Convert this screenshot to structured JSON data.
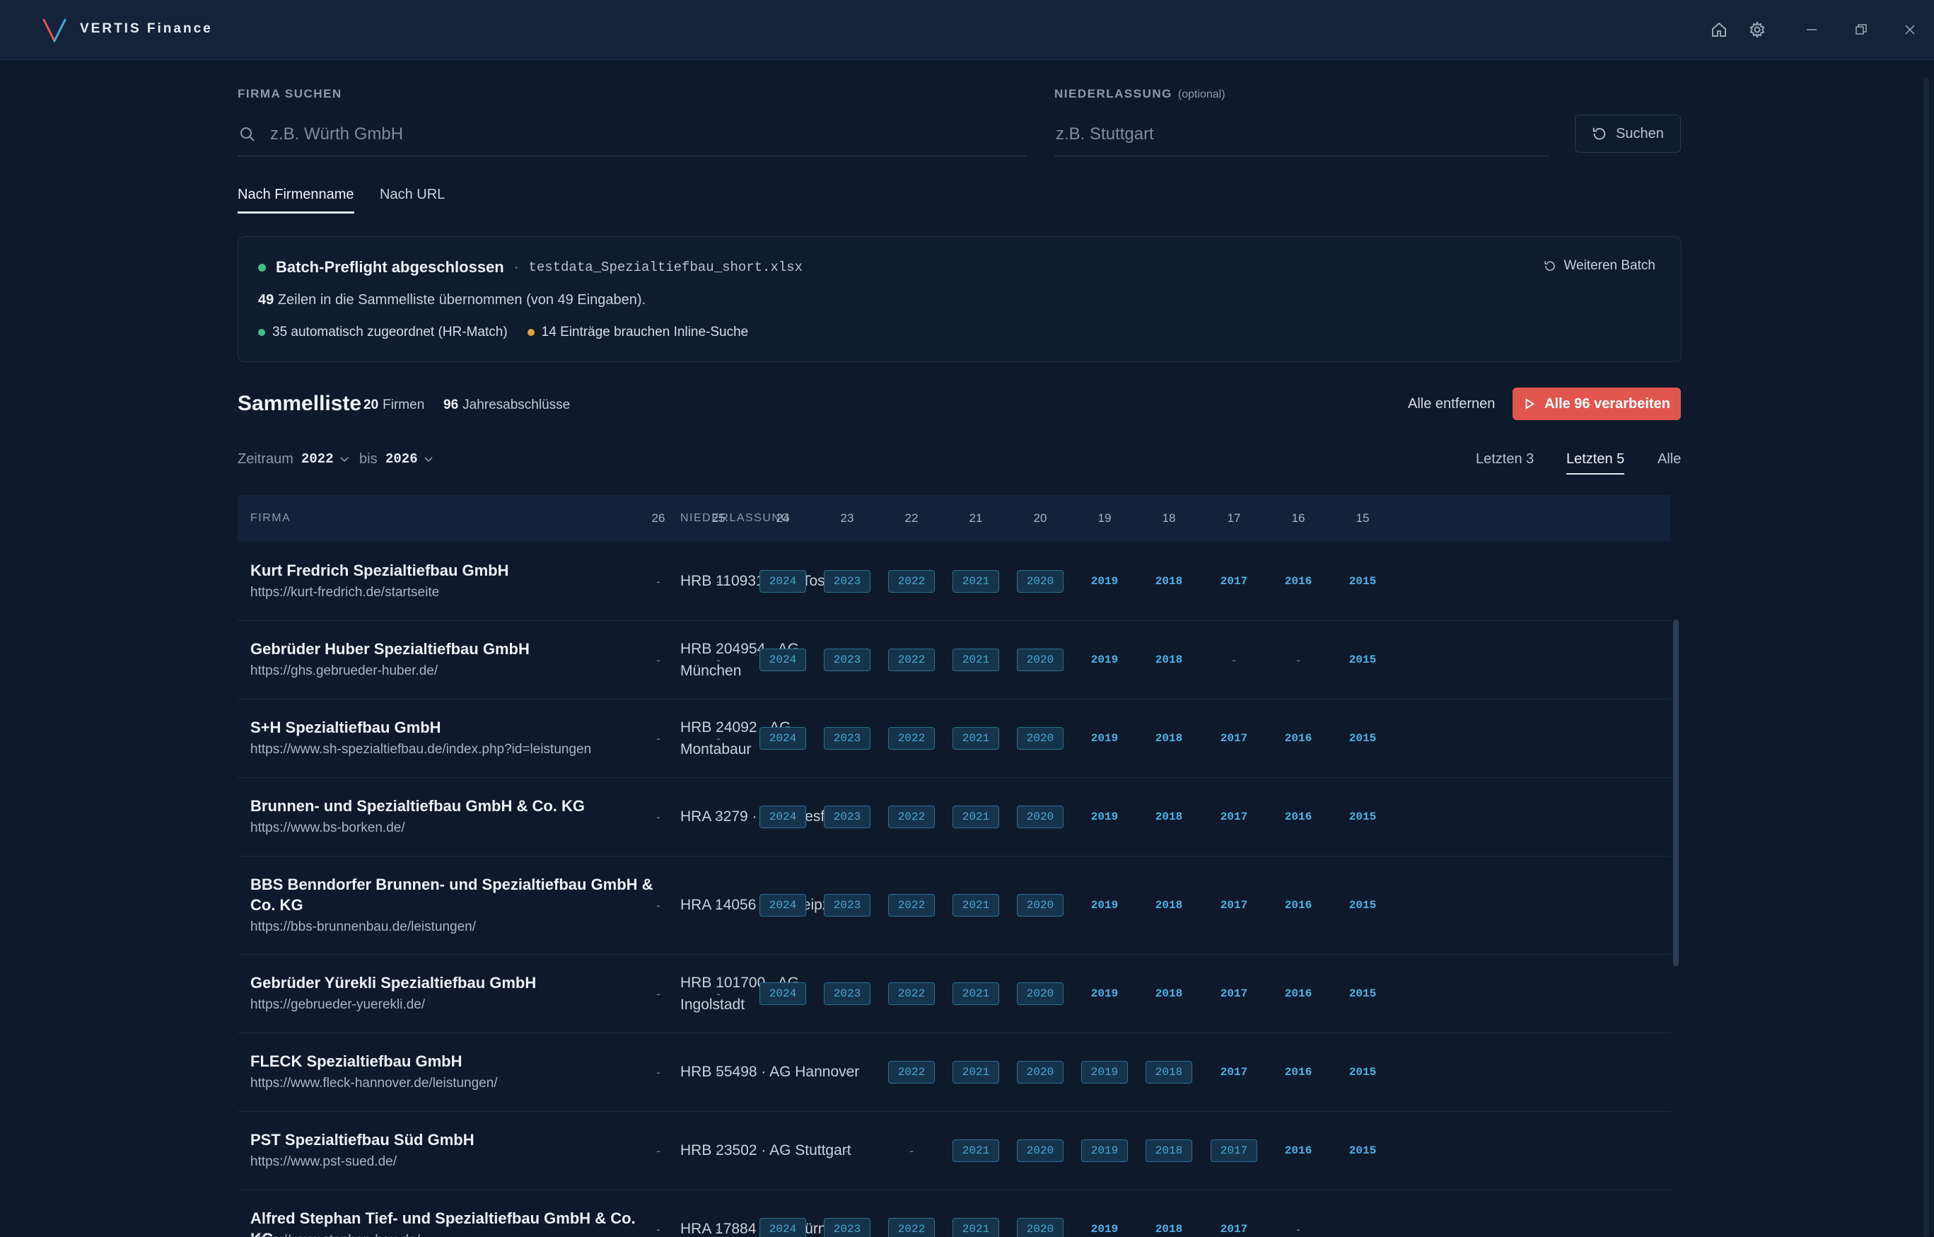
{
  "app": {
    "title": "VERTIS Finance"
  },
  "search": {
    "firm_label": "FIRMA SUCHEN",
    "firm_placeholder": "z.B. Würth GmbH",
    "branch_label": "NIEDERLASSUNG",
    "branch_optional": "(optional)",
    "branch_placeholder": "z.B. Stuttgart",
    "search_button": "Suchen"
  },
  "tabs": [
    {
      "label": "Nach Firmenname",
      "active": true
    },
    {
      "label": "Nach URL",
      "active": false
    }
  ],
  "batch": {
    "title": "Batch-Preflight abgeschlossen",
    "separator": "·",
    "filename": "testdata_Spezialtiefbau_short.xlsx",
    "count": "49",
    "summary": "Zeilen in die Sammelliste übernommen (von 49 Eingaben).",
    "matched": "35 automatisch zugeordnet (HR-Match)",
    "inline": "14 Einträge brauchen Inline-Suche",
    "more_button": "Weiteren Batch",
    "status_colors": {
      "ok": "#3fc08a",
      "pending": "#e3a13b"
    }
  },
  "sammelliste": {
    "title": "Sammelliste",
    "firms_count": "20",
    "firms_label": "Firmen",
    "reports_count": "96",
    "reports_label": "Jahresabschlüsse",
    "remove_all": "Alle entfernen",
    "process_all": "Alle 96 verarbeiten"
  },
  "period": {
    "label": "Zeitraum",
    "from": "2022",
    "to_label": "bis",
    "to": "2026",
    "quick": [
      {
        "label": "Letzten 3",
        "active": false
      },
      {
        "label": "Letzten 5",
        "active": true
      },
      {
        "label": "Alle",
        "active": false
      }
    ]
  },
  "table": {
    "col_firma": "FIRMA",
    "col_niederlassung": "NIEDERLASSUNG",
    "years": [
      "26",
      "25",
      "24",
      "23",
      "22",
      "21",
      "20",
      "19",
      "18",
      "17",
      "16",
      "15"
    ],
    "rows": [
      {
        "name": "Kurt Fredrich Spezialtiefbau GmbH",
        "url": "https://kurt-fredrich.de/startseite",
        "branch": "HRB 110931 · AG Tostedt",
        "cells": [
          [
            "-",
            ""
          ],
          [
            "-",
            ""
          ],
          [
            "2024",
            "box"
          ],
          [
            "2023",
            "box"
          ],
          [
            "2022",
            "box"
          ],
          [
            "2021",
            "box"
          ],
          [
            "2020",
            "box"
          ],
          [
            "2019",
            "plain"
          ],
          [
            "2018",
            "plain"
          ],
          [
            "2017",
            "plain"
          ],
          [
            "2016",
            "plain"
          ],
          [
            "2015",
            "plain"
          ]
        ]
      },
      {
        "name": "Gebrüder Huber Spezialtiefbau GmbH",
        "url": "https://ghs.gebrueder-huber.de/",
        "branch": "HRB 204954 · AG München",
        "cells": [
          [
            "-",
            ""
          ],
          [
            "-",
            ""
          ],
          [
            "2024",
            "box"
          ],
          [
            "2023",
            "box"
          ],
          [
            "2022",
            "box"
          ],
          [
            "2021",
            "box"
          ],
          [
            "2020",
            "box"
          ],
          [
            "2019",
            "plain"
          ],
          [
            "2018",
            "plain"
          ],
          [
            "-",
            ""
          ],
          [
            "-",
            ""
          ],
          [
            "2015",
            "plain"
          ]
        ]
      },
      {
        "name": "S+H Spezialtiefbau GmbH",
        "url": "https://www.sh-spezialtiefbau.de/index.php?id=leistungen",
        "branch": "HRB 24092 · AG Montabaur",
        "cells": [
          [
            "-",
            ""
          ],
          [
            "-",
            ""
          ],
          [
            "2024",
            "box"
          ],
          [
            "2023",
            "box"
          ],
          [
            "2022",
            "box"
          ],
          [
            "2021",
            "box"
          ],
          [
            "2020",
            "box"
          ],
          [
            "2019",
            "plain"
          ],
          [
            "2018",
            "plain"
          ],
          [
            "2017",
            "plain"
          ],
          [
            "2016",
            "plain"
          ],
          [
            "2015",
            "plain"
          ]
        ]
      },
      {
        "name": "Brunnen- und Spezialtiefbau GmbH & Co. KG",
        "url": "https://www.bs-borken.de/",
        "branch": "HRA 3279 · AG Coesfeld",
        "cells": [
          [
            "-",
            ""
          ],
          [
            "-",
            ""
          ],
          [
            "2024",
            "box"
          ],
          [
            "2023",
            "box"
          ],
          [
            "2022",
            "box"
          ],
          [
            "2021",
            "box"
          ],
          [
            "2020",
            "box"
          ],
          [
            "2019",
            "plain"
          ],
          [
            "2018",
            "plain"
          ],
          [
            "2017",
            "plain"
          ],
          [
            "2016",
            "plain"
          ],
          [
            "2015",
            "plain"
          ]
        ]
      },
      {
        "name": "BBS Benndorfer Brunnen- und Spezialtiefbau GmbH & Co. KG",
        "url": "https://bbs-brunnenbau.de/leistungen/",
        "branch": "HRA 14056 · AG Leipzig",
        "cells": [
          [
            "-",
            ""
          ],
          [
            "-",
            ""
          ],
          [
            "2024",
            "box"
          ],
          [
            "2023",
            "box"
          ],
          [
            "2022",
            "box"
          ],
          [
            "2021",
            "box"
          ],
          [
            "2020",
            "box"
          ],
          [
            "2019",
            "plain"
          ],
          [
            "2018",
            "plain"
          ],
          [
            "2017",
            "plain"
          ],
          [
            "2016",
            "plain"
          ],
          [
            "2015",
            "plain"
          ]
        ]
      },
      {
        "name": "Gebrüder Yürekli Spezialtiefbau GmbH",
        "url": "https://gebrueder-yuerekli.de/",
        "branch": "HRB 101700 · AG Ingolstadt",
        "cells": [
          [
            "-",
            ""
          ],
          [
            "-",
            ""
          ],
          [
            "2024",
            "box"
          ],
          [
            "2023",
            "box"
          ],
          [
            "2022",
            "box"
          ],
          [
            "2021",
            "box"
          ],
          [
            "2020",
            "box"
          ],
          [
            "2019",
            "plain"
          ],
          [
            "2018",
            "plain"
          ],
          [
            "2017",
            "plain"
          ],
          [
            "2016",
            "plain"
          ],
          [
            "2015",
            "plain"
          ]
        ]
      },
      {
        "name": "FLECK Spezialtiefbau GmbH",
        "url": "https://www.fleck-hannover.de/leistungen/",
        "branch": "HRB 55498 · AG Hannover",
        "cells": [
          [
            "-",
            ""
          ],
          [
            "-",
            ""
          ],
          [
            "-",
            ""
          ],
          [
            "-",
            ""
          ],
          [
            "2022",
            "box"
          ],
          [
            "2021",
            "box"
          ],
          [
            "2020",
            "box"
          ],
          [
            "2019",
            "box"
          ],
          [
            "2018",
            "box"
          ],
          [
            "2017",
            "plain"
          ],
          [
            "2016",
            "plain"
          ],
          [
            "2015",
            "plain"
          ]
        ]
      },
      {
        "name": "PST Spezialtiefbau Süd GmbH",
        "url": "https://www.pst-sued.de/",
        "branch": "HRB 23502 · AG Stuttgart",
        "cells": [
          [
            "-",
            ""
          ],
          [
            "-",
            ""
          ],
          [
            "-",
            ""
          ],
          [
            "-",
            ""
          ],
          [
            "-",
            ""
          ],
          [
            "2021",
            "box"
          ],
          [
            "2020",
            "box"
          ],
          [
            "2019",
            "box"
          ],
          [
            "2018",
            "box"
          ],
          [
            "2017",
            "box"
          ],
          [
            "2016",
            "plain"
          ],
          [
            "2015",
            "plain"
          ]
        ]
      },
      {
        "name": "Alfred Stephan Tief- und Spezialtiefbau GmbH & Co. KG",
        "url": "https://www.stephan-bau.de/",
        "branch": "HRA 17884 · AG Nürnberg",
        "cells": [
          [
            "-",
            ""
          ],
          [
            "-",
            ""
          ],
          [
            "2024",
            "box"
          ],
          [
            "2023",
            "box"
          ],
          [
            "2022",
            "box"
          ],
          [
            "2021",
            "box"
          ],
          [
            "2020",
            "box"
          ],
          [
            "2019",
            "plain"
          ],
          [
            "2018",
            "plain"
          ],
          [
            "2017",
            "plain"
          ],
          [
            "-",
            ""
          ],
          [
            "",
            ""
          ]
        ]
      }
    ]
  }
}
